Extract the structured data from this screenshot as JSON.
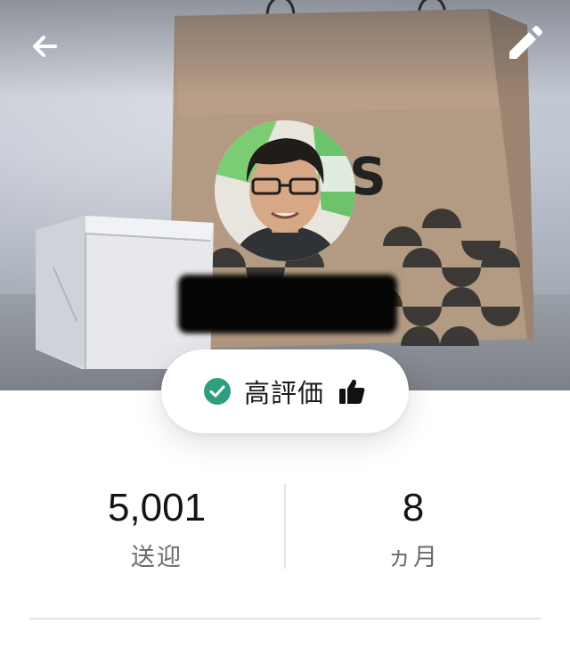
{
  "header": {
    "back_icon": "arrow-left-icon",
    "edit_icon": "pencil-icon"
  },
  "profile": {
    "avatar_icon": "avatar",
    "name_redacted": true
  },
  "rating_badge": {
    "label": "高評価",
    "check_icon": "check-circle-icon",
    "thumb_icon": "thumbs-up-icon",
    "check_color": "#2e9e7f"
  },
  "stats": {
    "trips": {
      "value": "5,001",
      "caption": "送迎"
    },
    "months": {
      "value": "8",
      "caption": "ヵ月"
    }
  }
}
